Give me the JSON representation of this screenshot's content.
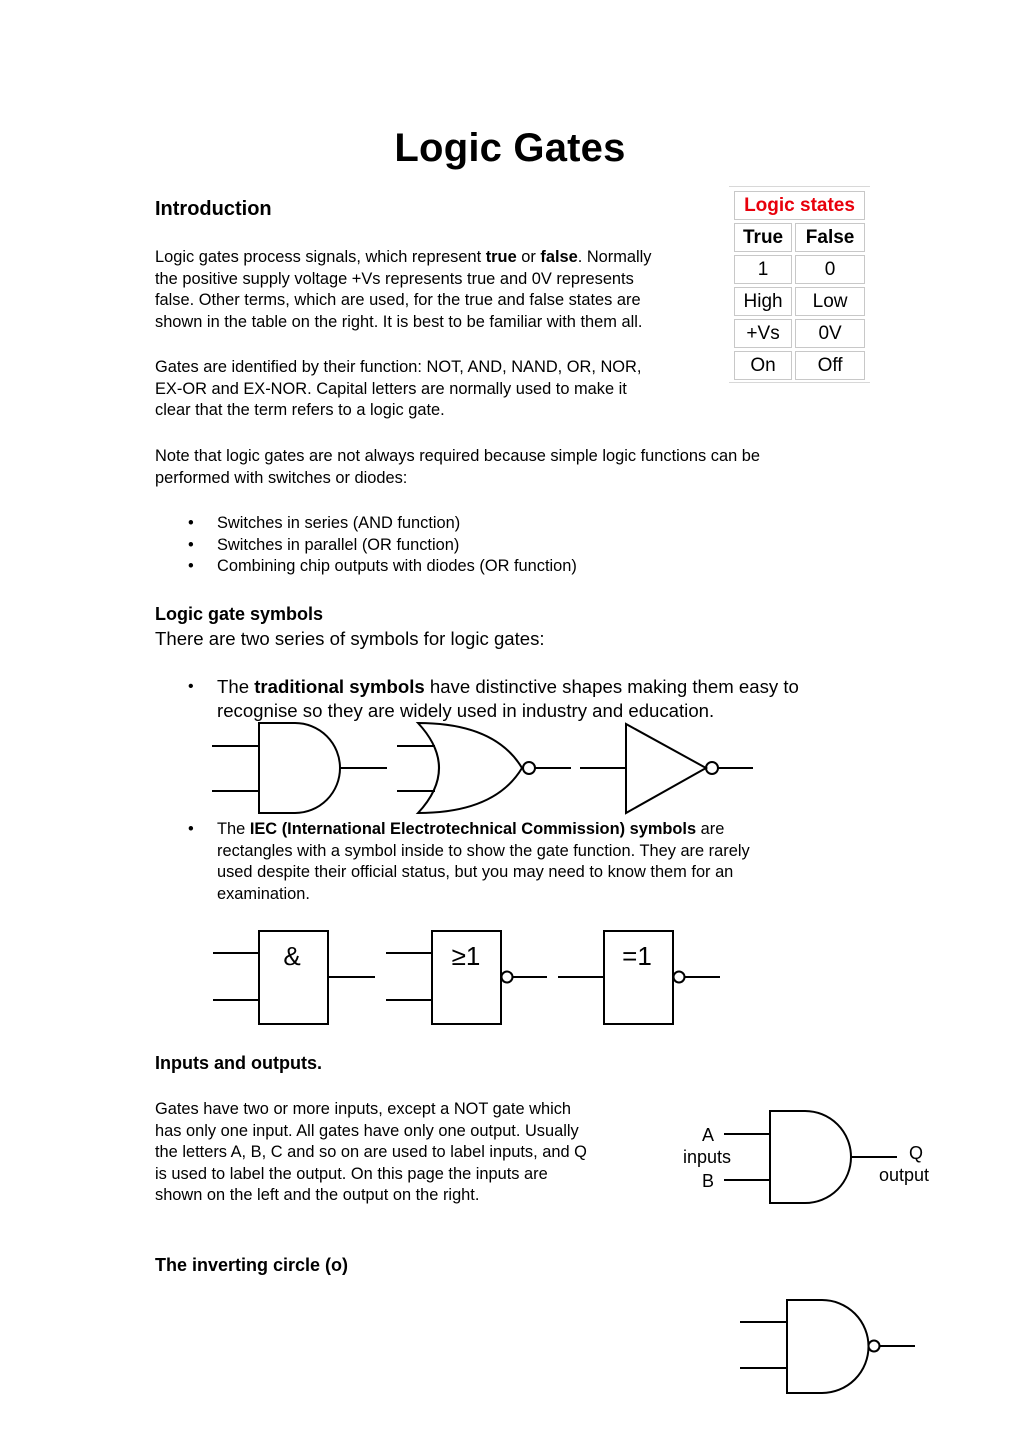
{
  "page": {
    "title": "Logic Gates"
  },
  "introduction": {
    "heading": "Introduction",
    "para1": {
      "part1": "Logic gates process signals, which represent ",
      "bold1": "true",
      "part2": " or ",
      "bold2": "false",
      "part3": ". Normally",
      "line2": "the positive supply voltage +Vs represents true and 0V represents",
      "line3": "false. Other terms, which are used, for the true and false states are",
      "line4": "shown in the table on the right. It is best to be familiar with them all."
    },
    "para2": {
      "line1": "Gates are identified by their function: NOT, AND, NAND, OR, NOR,",
      "line2": "EX-OR and EX-NOR. Capital letters are normally used to make it",
      "line3": "clear that the term refers to a logic gate."
    },
    "para3": {
      "line1": "Note that logic gates are not always required because simple logic functions can be",
      "line2": "performed with switches or diodes:"
    },
    "bullets": [
      "Switches in series (AND function)",
      "Switches in parallel (OR function)",
      "Combining chip outputs with diodes (OR function)"
    ]
  },
  "logic_states": {
    "caption": "Logic states",
    "caption_color": "#e8000b",
    "headers": [
      "True",
      "False"
    ],
    "rows": [
      [
        "1",
        "0"
      ],
      [
        "High",
        "Low"
      ],
      [
        "+Vs",
        "0V"
      ],
      [
        "On",
        "Off"
      ]
    ]
  },
  "symbols": {
    "heading": "Logic gate symbols",
    "intro": "There are two series of symbols for logic gates:",
    "traditional": {
      "pre": "The ",
      "bold": "traditional symbols",
      "post": " have distinctive shapes making them easy to",
      "line2": "recognise so they are widely used in industry and education.",
      "gates": [
        "AND",
        "NOR",
        "NOT"
      ]
    },
    "iec": {
      "pre": "The ",
      "bold": "IEC (International Electrotechnical Commission) symbols",
      "post": " are",
      "line2": "rectangles with a symbol inside to show the gate function. They are rarely",
      "line3": "used despite their official status, but you may need to know them for an",
      "line4": "examination.",
      "gate_labels": [
        "&",
        "≥1",
        "=1"
      ]
    }
  },
  "inputs_outputs": {
    "heading": "Inputs and outputs.",
    "lines": [
      "Gates have two or more inputs, except a NOT gate which",
      "has only one input. All gates have only one output. Usually",
      "the letters A, B, C and so on are used to label inputs, and Q",
      "is used to label the output. On this page the inputs are",
      "shown on the left and the output on the right."
    ],
    "diagram": {
      "input_a": "A",
      "inputs_label": "inputs",
      "input_b": "B",
      "output_q": "Q",
      "output_label": "output"
    }
  },
  "inverting": {
    "heading": "The inverting circle (o)"
  }
}
